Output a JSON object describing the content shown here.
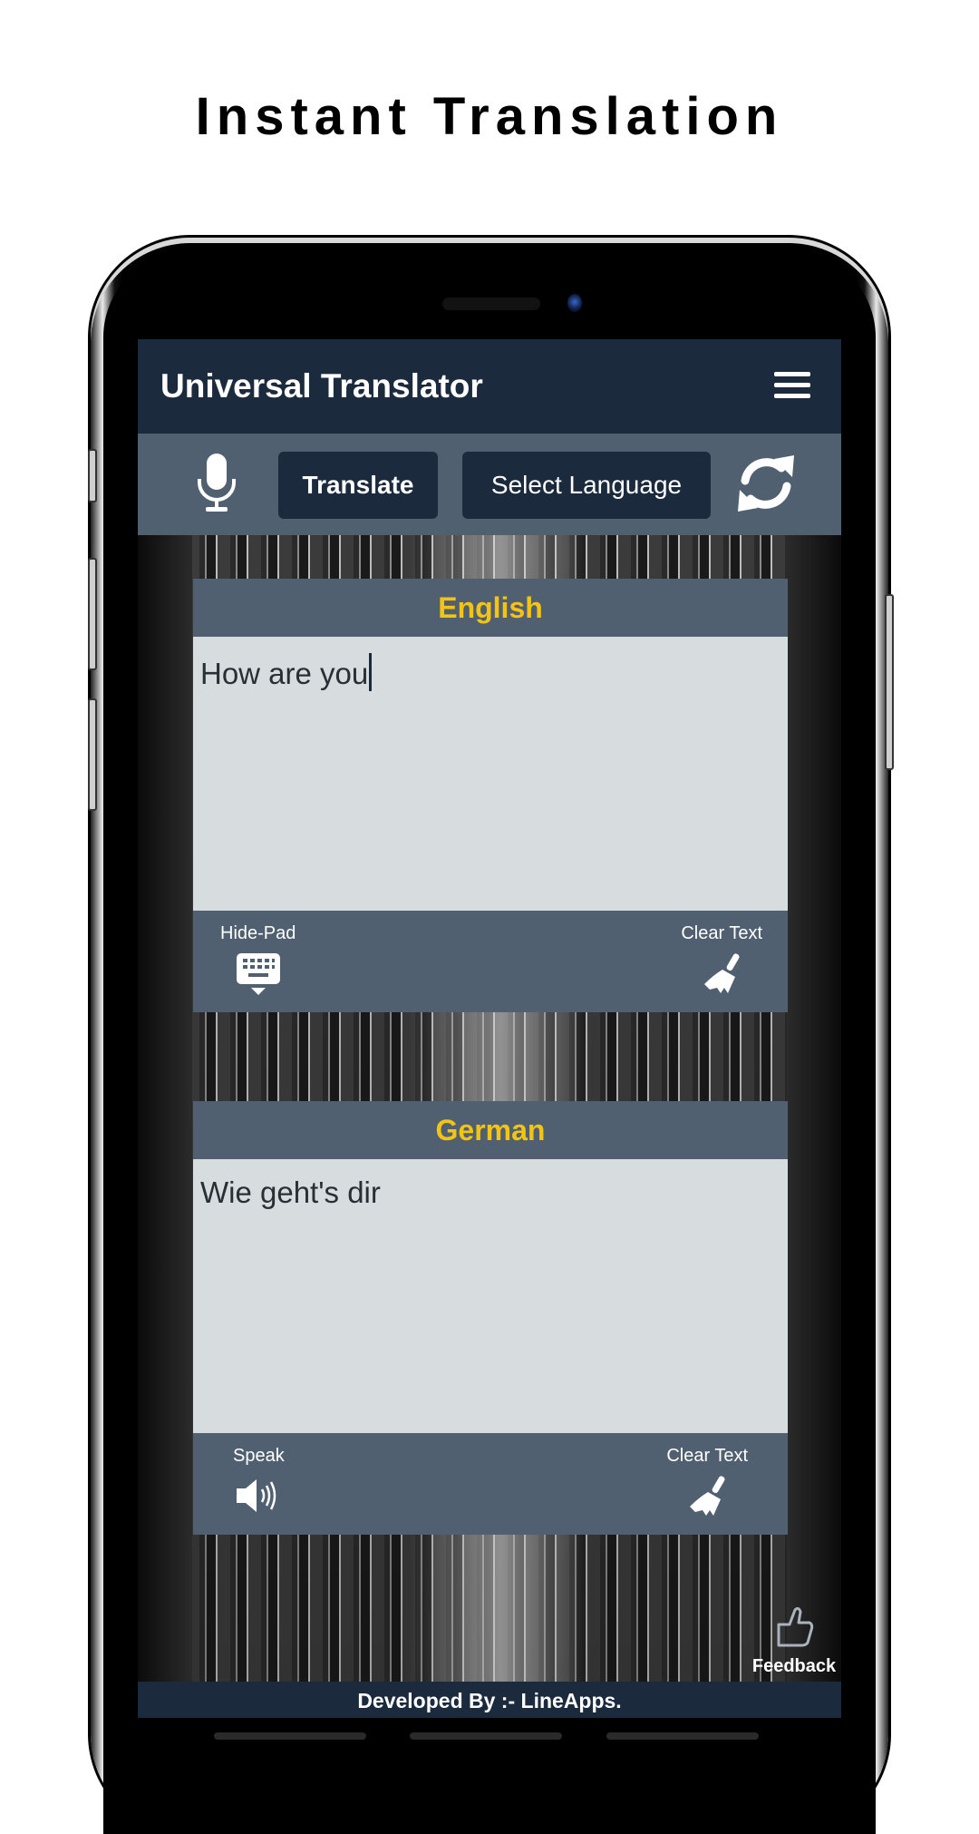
{
  "promo": {
    "title": "Instant Translation"
  },
  "app": {
    "title": "Universal Translator",
    "menu_icon": "hamburger-menu-icon"
  },
  "toolbar": {
    "mic_icon": "microphone-icon",
    "translate_label": "Translate",
    "select_language_label": "Select Language",
    "swap_icon": "refresh-swap-icon"
  },
  "source_panel": {
    "language": "English",
    "text": "How are you",
    "left_action": {
      "label": "Hide-Pad",
      "icon": "keyboard-hide-icon"
    },
    "right_action": {
      "label": "Clear Text",
      "icon": "broom-icon"
    }
  },
  "target_panel": {
    "language": "German",
    "text": "Wie geht's dir",
    "left_action": {
      "label": "Speak",
      "icon": "speaker-icon"
    },
    "right_action": {
      "label": "Clear Text",
      "icon": "broom-icon"
    }
  },
  "feedback": {
    "label": "Feedback",
    "icon": "thumbs-up-icon"
  },
  "footer": {
    "developer": "Developed By :- LineApps."
  },
  "colors": {
    "header_bg": "#1b2a3c",
    "toolbar_bg": "#506070",
    "accent_yellow": "#f3c316",
    "text_area_bg": "#d7dcdf"
  }
}
